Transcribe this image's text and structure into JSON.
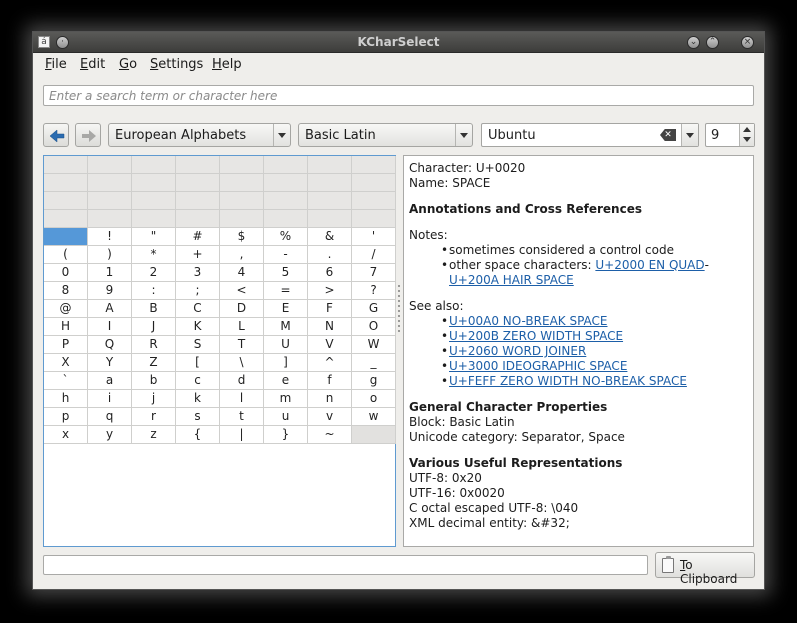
{
  "window": {
    "title": "KCharSelect",
    "app_icon_glyph": "á"
  },
  "menu": [
    {
      "label": "File",
      "mnemonic": "F",
      "rest": "ile"
    },
    {
      "label": "Edit",
      "mnemonic": "E",
      "rest": "dit"
    },
    {
      "label": "Go",
      "mnemonic": "G",
      "rest": "o"
    },
    {
      "label": "Settings",
      "mnemonic": "S",
      "rest": "ettings"
    },
    {
      "label": "Help",
      "mnemonic": "H",
      "rest": "elp"
    }
  ],
  "search": {
    "placeholder": "Enter a search term or character here"
  },
  "toolbar": {
    "section": "European Alphabets",
    "block": "Basic Latin",
    "font": "Ubuntu",
    "font_size": "9"
  },
  "grid": {
    "empty_rows": 4,
    "selected": "U+0020",
    "rows": [
      [
        " ",
        "!",
        "\"",
        "#",
        "$",
        "%",
        "&",
        "'"
      ],
      [
        "(",
        ")",
        "*",
        "+",
        ",",
        "-",
        ".",
        "/"
      ],
      [
        "0",
        "1",
        "2",
        "3",
        "4",
        "5",
        "6",
        "7"
      ],
      [
        "8",
        "9",
        ":",
        ";",
        "<",
        "=",
        ">",
        "?"
      ],
      [
        "@",
        "A",
        "B",
        "C",
        "D",
        "E",
        "F",
        "G"
      ],
      [
        "H",
        "I",
        "J",
        "K",
        "L",
        "M",
        "N",
        "O"
      ],
      [
        "P",
        "Q",
        "R",
        "S",
        "T",
        "U",
        "V",
        "W"
      ],
      [
        "X",
        "Y",
        "Z",
        "[",
        "\\",
        "]",
        "^",
        "_"
      ],
      [
        "`",
        "a",
        "b",
        "c",
        "d",
        "e",
        "f",
        "g"
      ],
      [
        "h",
        "i",
        "j",
        "k",
        "l",
        "m",
        "n",
        "o"
      ],
      [
        "p",
        "q",
        "r",
        "s",
        "t",
        "u",
        "v",
        "w"
      ],
      [
        "x",
        "y",
        "z",
        "{",
        "|",
        "}",
        "~",
        ""
      ]
    ]
  },
  "info": {
    "character": "Character: U+0020",
    "name": "Name: SPACE",
    "annotations_heading": "Annotations and Cross References",
    "notes_label": "Notes:",
    "note_1": "sometimes considered a control code",
    "note_2_prefix": "other space characters: ",
    "note_2_link_1": " U+2000 EN QUAD",
    "note_2_sep": "- ",
    "note_2_link_2": "U+200A HAIR SPACE",
    "see_also_label": "See also:",
    "see_also": [
      " U+00A0 NO-BREAK SPACE",
      " U+200B ZERO WIDTH SPACE",
      " U+2060 WORD JOINER",
      "U+3000 IDEOGRAPHIC SPACE",
      " U+FEFF ZERO WIDTH NO-BREAK SPACE"
    ],
    "general_heading": "General Character Properties",
    "block": "Block: Basic Latin",
    "category": "Unicode category: Separator, Space",
    "reps_heading": "Various Useful Representations",
    "utf8": "UTF-8: 0x20",
    "utf16": "UTF-16: 0x0020",
    "octal": "C octal escaped UTF-8: \\040",
    "xml": "XML decimal entity: &#32;"
  },
  "clipboard": {
    "value": "",
    "button_mnemonic": "T",
    "button_rest": "o Clipboard"
  },
  "colors": {
    "link": "#1d5fa8",
    "selection": "#5598d8",
    "focus_border": "#5f9ad0"
  }
}
